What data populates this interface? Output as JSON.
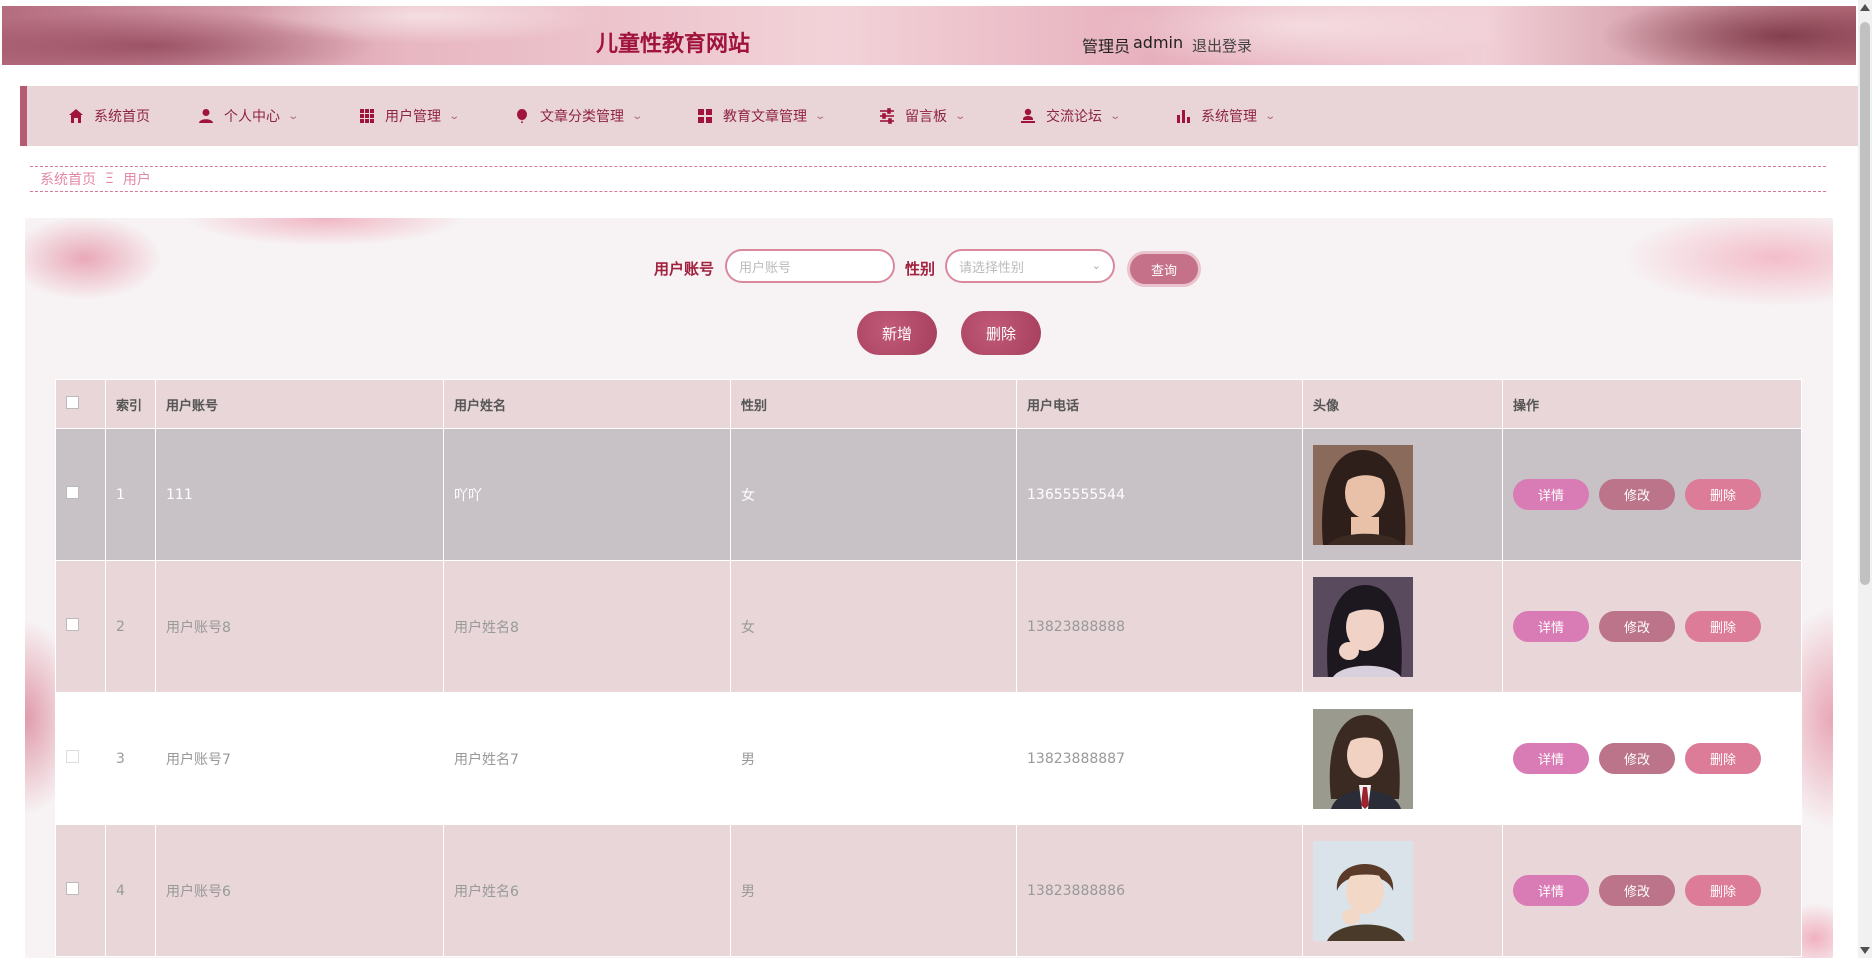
{
  "header": {
    "title": "儿童性教育网站",
    "admin_label": "管理员",
    "admin_name": "admin",
    "logout": "退出登录"
  },
  "nav": {
    "items": [
      {
        "label": "系统首页",
        "icon": "home-icon",
        "dropdown": false
      },
      {
        "label": "个人中心",
        "icon": "person-icon",
        "dropdown": true
      },
      {
        "label": "用户管理",
        "icon": "grid-icon",
        "dropdown": true
      },
      {
        "label": "文章分类管理",
        "icon": "balloon-icon",
        "dropdown": true
      },
      {
        "label": "教育文章管理",
        "icon": "apps-icon",
        "dropdown": true
      },
      {
        "label": "留言板",
        "icon": "sliders-icon",
        "dropdown": true
      },
      {
        "label": "交流论坛",
        "icon": "user-stand-icon",
        "dropdown": true
      },
      {
        "label": "系统管理",
        "icon": "bar-chart-icon",
        "dropdown": true
      }
    ]
  },
  "breadcrumb": {
    "home": "系统首页",
    "separator": "Ξ",
    "current": "用户"
  },
  "search": {
    "account_label": "用户账号",
    "account_placeholder": "用户账号",
    "gender_label": "性别",
    "gender_placeholder": "请选择性别",
    "query_button": "查询"
  },
  "actions": {
    "add": "新增",
    "delete": "删除"
  },
  "table": {
    "headers": [
      "索引",
      "用户账号",
      "用户姓名",
      "性别",
      "用户电话",
      "头像",
      "操作"
    ],
    "rows": [
      {
        "index": "1",
        "account": "111",
        "name": "吖吖",
        "gender": "女",
        "phone": "13655555544",
        "avatar": "avatar-1"
      },
      {
        "index": "2",
        "account": "用户账号8",
        "name": "用户姓名8",
        "gender": "女",
        "phone": "13823888888",
        "avatar": "avatar-2"
      },
      {
        "index": "3",
        "account": "用户账号7",
        "name": "用户姓名7",
        "gender": "男",
        "phone": "13823888887",
        "avatar": "avatar-3"
      },
      {
        "index": "4",
        "account": "用户账号6",
        "name": "用户姓名6",
        "gender": "男",
        "phone": "13823888886",
        "avatar": "avatar-4"
      }
    ],
    "ops": {
      "detail": "详情",
      "edit": "修改",
      "delete": "删除"
    }
  },
  "colors": {
    "primary": "#a0143c",
    "nav_bg": "#e9d5d8",
    "detail_btn": "#d97cb6",
    "edit_btn": "#bb7489",
    "delete_btn": "#dd7c98"
  }
}
